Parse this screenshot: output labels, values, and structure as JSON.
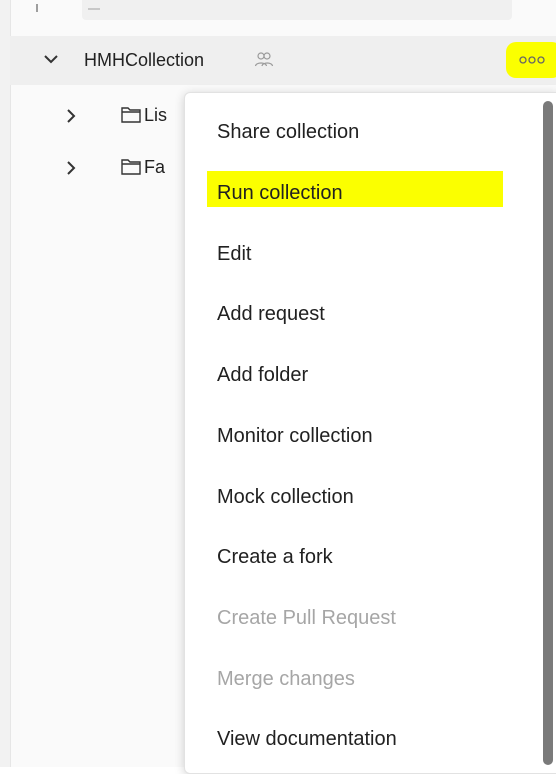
{
  "collection": {
    "name": "HMHCollection",
    "more_icon": "more-horizontal-icon",
    "shared_icon": "people-icon"
  },
  "tree": {
    "items": [
      {
        "label": "Lis",
        "icon": "folder-icon"
      },
      {
        "label": "Fa",
        "icon": "folder-icon"
      }
    ]
  },
  "menu": {
    "items": [
      {
        "label": "Share collection",
        "enabled": true
      },
      {
        "label": "Run collection",
        "enabled": true,
        "highlighted": true
      },
      {
        "label": "Edit",
        "enabled": true
      },
      {
        "label": "Add request",
        "enabled": true
      },
      {
        "label": "Add folder",
        "enabled": true
      },
      {
        "label": "Monitor collection",
        "enabled": true
      },
      {
        "label": "Mock collection",
        "enabled": true
      },
      {
        "label": "Create a fork",
        "enabled": true
      },
      {
        "label": "Create Pull Request",
        "enabled": false
      },
      {
        "label": "Merge changes",
        "enabled": false
      },
      {
        "label": "View documentation",
        "enabled": true
      }
    ]
  },
  "colors": {
    "highlight": "#fbff00",
    "text": "#212121",
    "disabled_text": "#a6a6a6",
    "row_bg": "#efefef"
  }
}
